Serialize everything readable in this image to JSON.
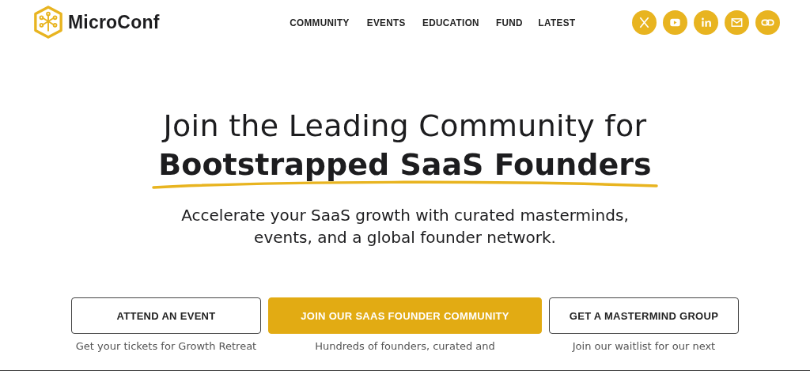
{
  "brand": {
    "name": "MicroConf"
  },
  "nav": [
    {
      "label": "COMMUNITY"
    },
    {
      "label": "EVENTS"
    },
    {
      "label": "EDUCATION"
    },
    {
      "label": "FUND"
    },
    {
      "label": "LATEST"
    }
  ],
  "social": [
    {
      "kind": "x"
    },
    {
      "kind": "youtube"
    },
    {
      "kind": "linkedin"
    },
    {
      "kind": "mail"
    },
    {
      "kind": "link"
    }
  ],
  "hero": {
    "title_line_1": "Join the Leading Community for",
    "title_line_2": "Bootstrapped SaaS Founders",
    "subtitle": "Accelerate your SaaS growth with curated masterminds, events, and a global founder network."
  },
  "actions": [
    {
      "label": "ATTEND AN EVENT",
      "kind": "outline",
      "caption": "Get your tickets for Growth Retreat"
    },
    {
      "label": "JOIN OUR SAAS FOUNDER COMMUNITY",
      "kind": "filled",
      "caption": "Hundreds of founders, curated and"
    },
    {
      "label": "GET A MASTERMIND GROUP",
      "kind": "outline",
      "caption": "Join our waitlist for our next"
    }
  ]
}
